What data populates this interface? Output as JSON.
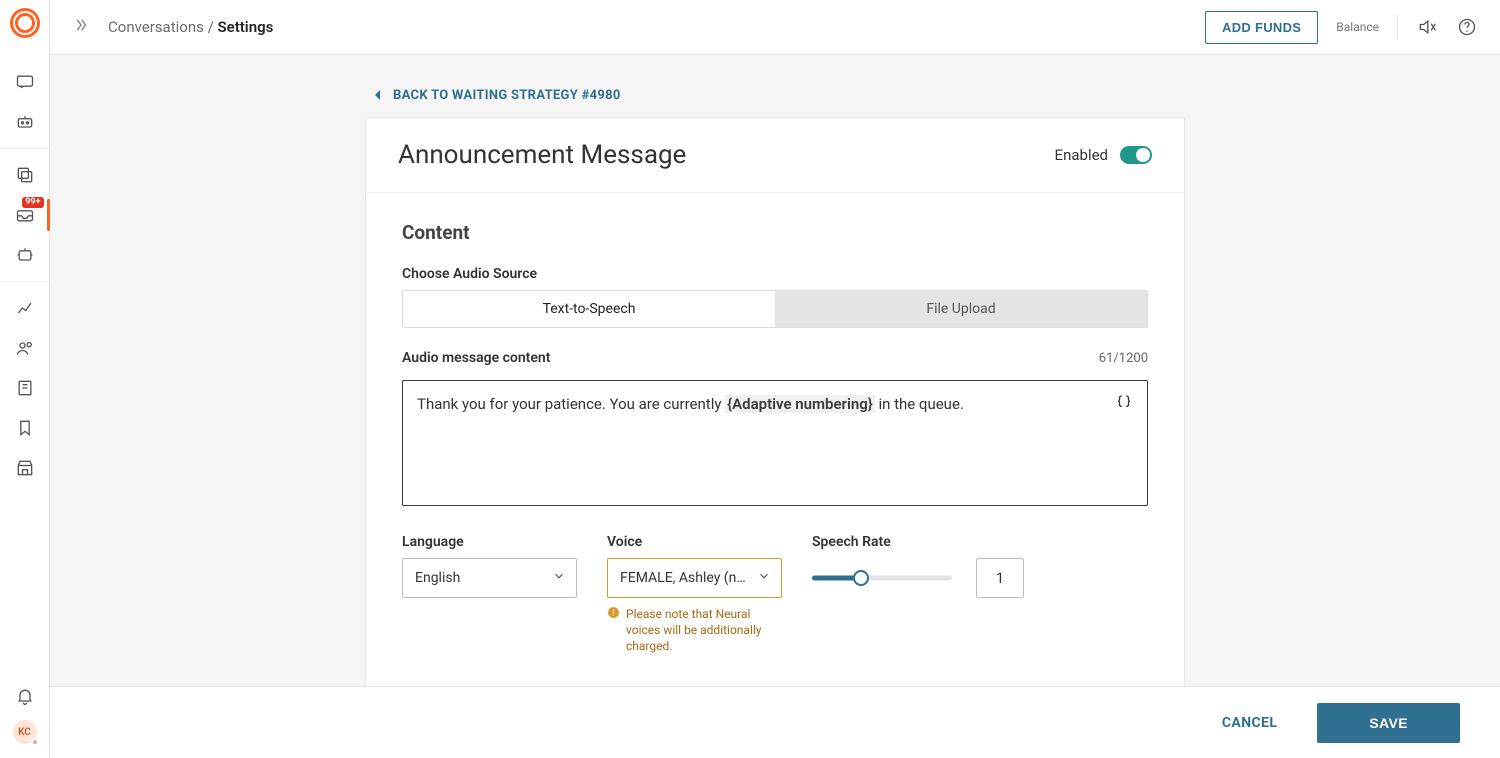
{
  "header": {
    "breadcrumb_parent": "Conversations",
    "breadcrumb_sep": " / ",
    "breadcrumb_current": "Settings",
    "add_funds": "ADD FUNDS",
    "balance_label": "Balance"
  },
  "rail": {
    "badge": "99+",
    "avatar_initials": "KC"
  },
  "back_link": "BACK TO WAITING STRATEGY #4980",
  "card": {
    "title": "Announcement Message",
    "enabled_label": "Enabled"
  },
  "content": {
    "section_title": "Content",
    "audio_source_label": "Choose Audio Source",
    "seg_tts": "Text-to-Speech",
    "seg_upload": "File Upload",
    "message_label": "Audio message content",
    "counter": "61/1200",
    "message_before": "Thank you for your patience. You are currently ",
    "message_chip": "{Adaptive numbering}",
    "message_after": " in the queue.",
    "language_label": "Language",
    "language_value": "English",
    "voice_label": "Voice",
    "voice_value": "FEMALE, Ashley (n...",
    "voice_warning": "Please note that Neural voices will be additionally charged.",
    "rate_label": "Speech Rate",
    "rate_value": "1"
  },
  "footer": {
    "cancel": "CANCEL",
    "save": "SAVE"
  }
}
